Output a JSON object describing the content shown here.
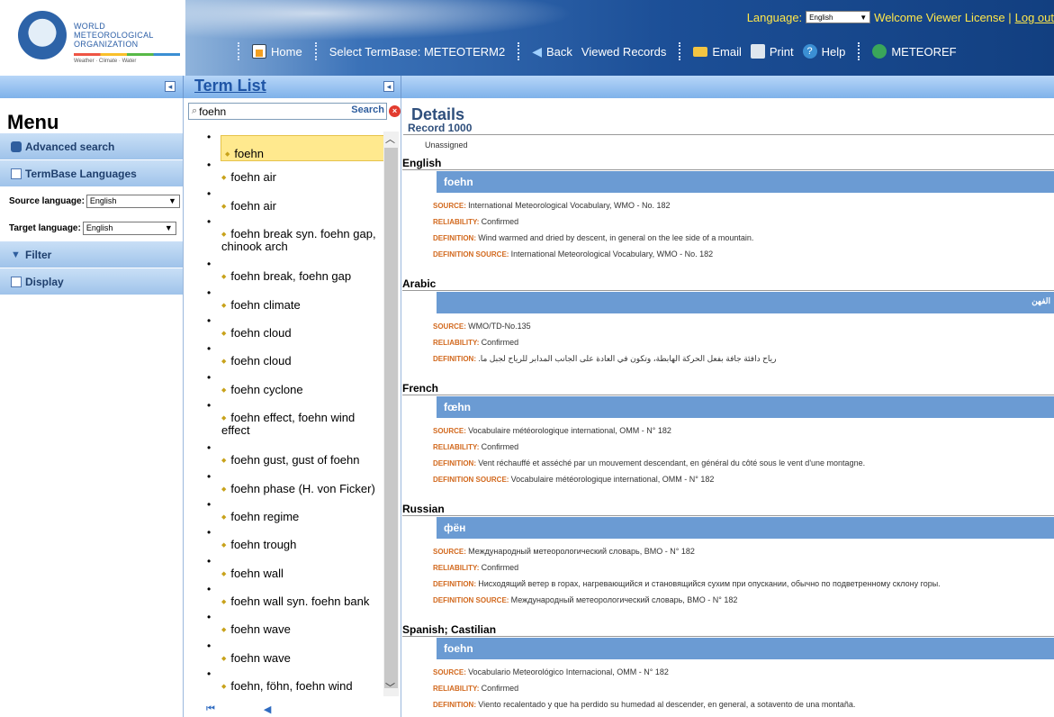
{
  "header": {
    "org_line1": "WORLD",
    "org_line2": "METEOROLOGICAL",
    "org_line3": "ORGANIZATION",
    "tagline": "Weather · Climate · Water",
    "language_label": "Language:",
    "language_value": "English",
    "welcome": "Welcome Viewer License |",
    "logout": "Log out"
  },
  "toolbar": {
    "home": "Home",
    "select_termbase": "Select TermBase: METEOTERM2",
    "back": "Back",
    "viewed_records": "Viewed Records",
    "email": "Email",
    "print": "Print",
    "help": "Help",
    "meteoref": "METEOREF"
  },
  "menu": {
    "title": "Menu",
    "advanced_search": "Advanced search",
    "termbase_languages": "TermBase Languages",
    "source_language_label": "Source language:",
    "source_language_value": "English",
    "target_language_label": "Target language:",
    "target_language_value": "English",
    "filter": "Filter",
    "display": "Display"
  },
  "term_list": {
    "title": "Term List",
    "search_value": "foehn",
    "search_button": "Search",
    "items": [
      "foehn",
      "foehn air",
      "foehn air",
      "foehn break syn. foehn gap, chinook arch",
      "foehn break, foehn gap",
      "foehn climate",
      "foehn cloud",
      "foehn cloud",
      "foehn cyclone",
      "foehn effect, foehn wind effect",
      "foehn gust, gust of foehn",
      "foehn phase (H. von Ficker)",
      "foehn regime",
      "foehn trough",
      "foehn wall",
      "foehn wall syn. foehn bank",
      "foehn wave",
      "foehn wave",
      "foehn, föhn, foehn wind"
    ]
  },
  "details": {
    "title": "Details",
    "record": "Record 1000",
    "unassigned": "Unassigned",
    "english": {
      "lang": "English",
      "term": "foehn",
      "source_k": "SOURCE",
      "source": "International Meteorological Vocabulary, WMO - No. 182",
      "reliability_k": "RELIABILITY",
      "reliability": "Confirmed",
      "definition_k": "DEFINITION",
      "definition": "Wind warmed and dried by descent, in general on the lee side of a mountain.",
      "def_source_k": "DEFINITION SOURCE",
      "def_source": "International Meteorological Vocabulary, WMO - No. 182"
    },
    "arabic": {
      "lang": "Arabic",
      "term": "الفهن",
      "source_k": "SOURCE",
      "source": "WMO/TD-No.135",
      "reliability_k": "RELIABILITY",
      "reliability": "Confirmed",
      "definition_k": "DEFINITION",
      "definition": "رياح دافئة جافة بفعل الحركة الهابطة، وتكون في العادة على الجانب المدابر للرياح لجبل ما."
    },
    "french": {
      "lang": "French",
      "term": "fœhn",
      "source_k": "SOURCE",
      "source": "Vocabulaire météorologique international, OMM - N° 182",
      "reliability_k": "RELIABILITY",
      "reliability": "Confirmed",
      "definition_k": "DEFINITION",
      "definition": "Vent réchauffé et asséché par un mouvement descendant, en général du côté sous le vent d'une montagne.",
      "def_source_k": "DEFINITION SOURCE",
      "def_source": "Vocabulaire météorologique international, OMM - N° 182"
    },
    "russian": {
      "lang": "Russian",
      "term": "фён",
      "source_k": "SOURCE",
      "source": "Международный метеорологический словарь, ВМО - N° 182",
      "reliability_k": "RELIABILITY",
      "reliability": "Confirmed",
      "definition_k": "DEFINITION",
      "definition": "Нисходящий ветер в горах, нагревающийся и становящийся сухим при опускании, обычно по подветренному склону горы.",
      "def_source_k": "DEFINITION SOURCE",
      "def_source": "Международный метеорологический словарь, ВМО - N° 182"
    },
    "spanish": {
      "lang": "Spanish; Castilian",
      "term": "foehn",
      "source_k": "SOURCE",
      "source": "Vocabulario Meteorológico Internacional, OMM - N° 182",
      "reliability_k": "RELIABILITY",
      "reliability": "Confirmed",
      "definition_k": "DEFINITION",
      "definition": "Viento recalentado y que ha perdido su humedad al descender, en general, a sotavento de una montaña."
    }
  }
}
